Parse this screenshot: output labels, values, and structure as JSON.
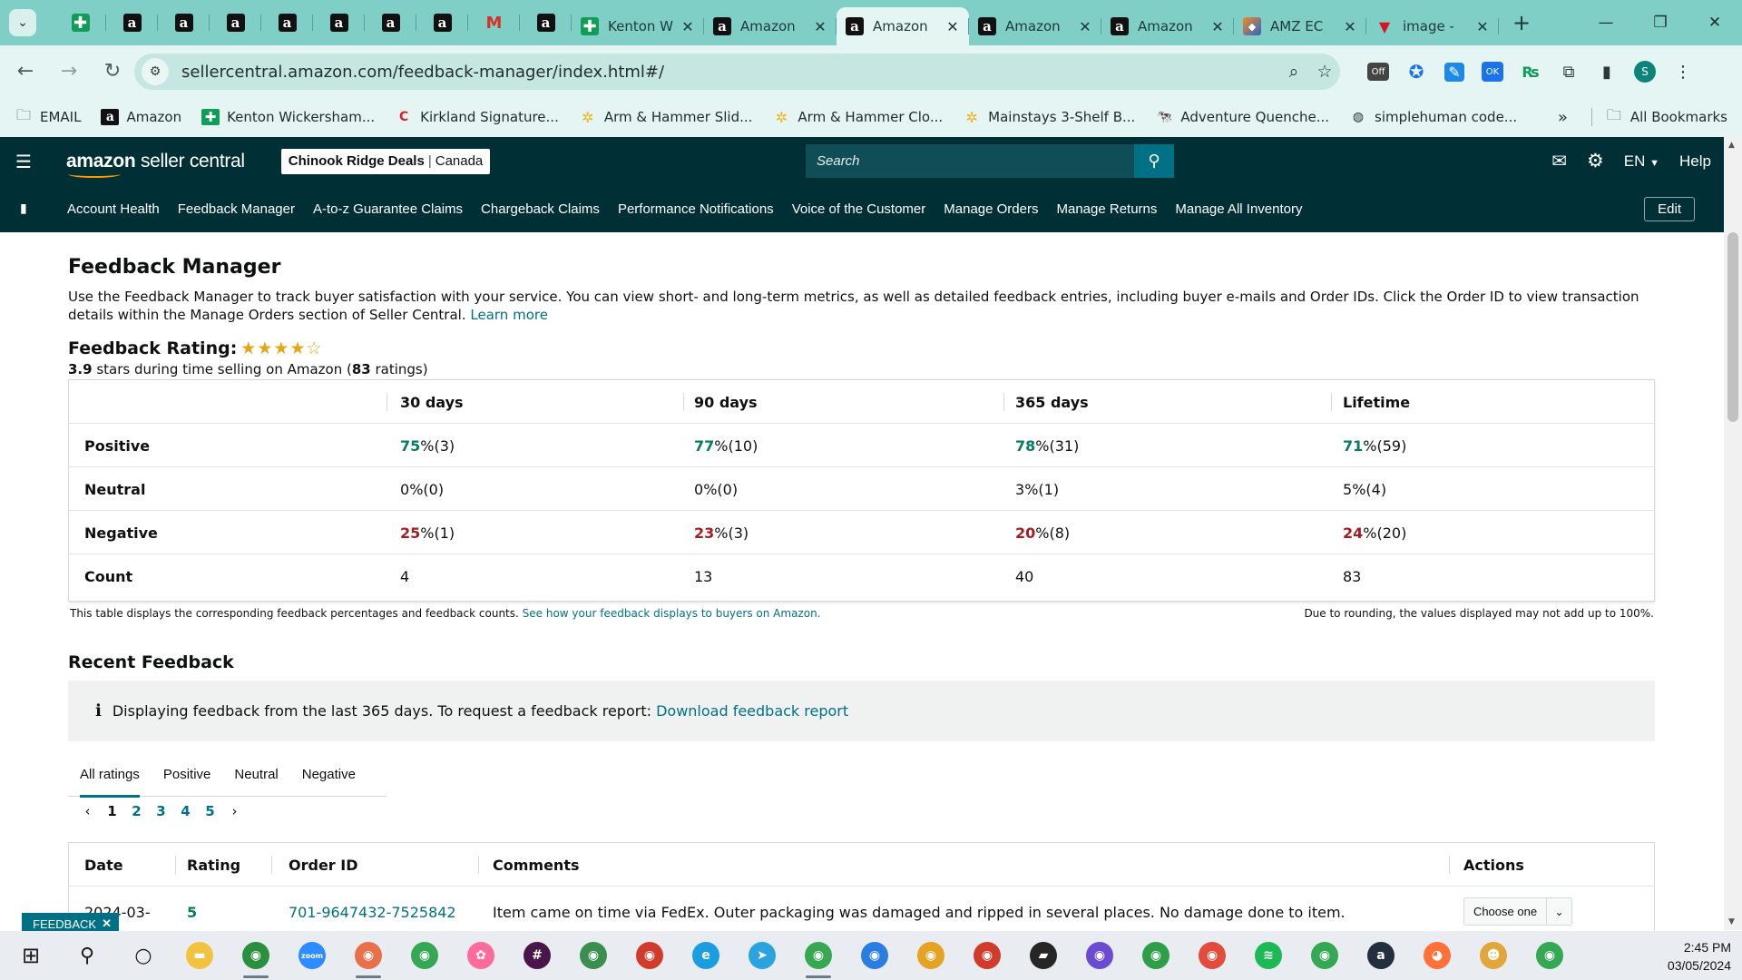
{
  "browser": {
    "pinned_tabs": [
      {
        "type": "sheets",
        "glyph": "✚"
      },
      {
        "type": "amazon",
        "glyph": "a"
      },
      {
        "type": "amazon",
        "glyph": "a"
      },
      {
        "type": "amazon",
        "glyph": "a"
      },
      {
        "type": "amazon",
        "glyph": "a"
      },
      {
        "type": "amazon",
        "glyph": "a"
      },
      {
        "type": "amazon",
        "glyph": "a"
      },
      {
        "type": "amazon",
        "glyph": "a"
      },
      {
        "type": "gmail",
        "glyph": "M"
      },
      {
        "type": "amazon",
        "glyph": "a"
      }
    ],
    "tabs": [
      {
        "title": "Kenton W",
        "icon": "sheets",
        "glyph": "✚",
        "active": false
      },
      {
        "title": "Amazon",
        "icon": "amazon",
        "glyph": "a",
        "active": false
      },
      {
        "title": "Amazon",
        "icon": "amazon",
        "glyph": "a",
        "active": true
      },
      {
        "title": "Amazon",
        "icon": "amazon",
        "glyph": "a",
        "active": false
      },
      {
        "title": "Amazon",
        "icon": "amazon",
        "glyph": "a",
        "active": false
      },
      {
        "title": "AMZ EC",
        "icon": "amz",
        "glyph": "◆",
        "active": false
      },
      {
        "title": "image -",
        "icon": "red",
        "glyph": "▼",
        "active": false
      }
    ],
    "tab_close": "✕",
    "new_tab": "+",
    "url": "sellercentral.amazon.com/feedback-manager/index.html#/",
    "extensions": [
      "zoom-icon",
      "star-icon",
      "off-extension-icon",
      "puzzle-ring-icon",
      "blue-note-icon",
      "ok-extension-icon",
      "rs-icon",
      "puzzle-icon",
      "sidepanel-icon",
      "profile-avatar"
    ],
    "profile_initial": "S",
    "ext_off_label": "Off",
    "ext_ok_label": "OK",
    "ext_rs_label": "₨",
    "bookmarks": [
      {
        "label": "EMAIL",
        "icon": "folder"
      },
      {
        "label": "Amazon",
        "icon": "amazon"
      },
      {
        "label": "Kenton Wickersham...",
        "icon": "sheets"
      },
      {
        "label": "Kirkland Signature...",
        "icon": "red"
      },
      {
        "label": "Arm & Hammer Slid...",
        "icon": "sun"
      },
      {
        "label": "Arm & Hammer Clo...",
        "icon": "sun"
      },
      {
        "label": "Mainstays 3-Shelf B...",
        "icon": "sun"
      },
      {
        "label": "Adventure Quenche...",
        "icon": "cow"
      },
      {
        "label": "simplehuman code...",
        "icon": "globe"
      }
    ],
    "bookmarks_overflow": "»",
    "all_bookmarks": "All Bookmarks"
  },
  "header": {
    "logo_main": "amazon",
    "logo_sub": "seller central",
    "store_name": "Chinook Ridge Deals",
    "store_region": "Canada",
    "search_placeholder": "Search",
    "language": "EN",
    "help": "Help"
  },
  "nav": {
    "items": [
      "Account Health",
      "Feedback Manager",
      "A-to-z Guarantee Claims",
      "Chargeback Claims",
      "Performance Notifications",
      "Voice of the Customer",
      "Manage Orders",
      "Manage Returns",
      "Manage All Inventory"
    ],
    "edit": "Edit"
  },
  "page": {
    "title": "Feedback Manager",
    "description": "Use the Feedback Manager to track buyer satisfaction with your service. You can view short- and long-term metrics, as well as detailed feedback entries, including buyer e-mails and Order IDs. Click the Order ID to view transaction details within the Manage Orders section of Seller Central.",
    "learn_more": "Learn more",
    "rating_label": "Feedback Rating:",
    "rating_stars": 4,
    "rating_value": "3.9",
    "rating_text_mid": " stars during time selling on Amazon (",
    "rating_count": "83",
    "rating_text_end": " ratings)"
  },
  "feedback_table": {
    "columns": [
      "30 days",
      "90 days",
      "365 days",
      "Lifetime"
    ],
    "rows": [
      {
        "label": "Positive",
        "color": "green",
        "cells": [
          {
            "pct": "75",
            "rest": " %(3)"
          },
          {
            "pct": "77",
            "rest": " %(10)"
          },
          {
            "pct": "78",
            "rest": " %(31)"
          },
          {
            "pct": "71",
            "rest": " %(59)"
          }
        ]
      },
      {
        "label": "Neutral",
        "color": "none",
        "cells": [
          {
            "pct": "0",
            "rest": " %(0)"
          },
          {
            "pct": "0",
            "rest": " %(0)"
          },
          {
            "pct": "3",
            "rest": " %(1)"
          },
          {
            "pct": "5",
            "rest": " %(4)"
          }
        ]
      },
      {
        "label": "Negative",
        "color": "red",
        "cells": [
          {
            "pct": "25",
            "rest": " %(1)"
          },
          {
            "pct": "23",
            "rest": " %(3)"
          },
          {
            "pct": "20",
            "rest": " %(8)"
          },
          {
            "pct": "24",
            "rest": " %(20)"
          }
        ]
      },
      {
        "label": "Count",
        "color": "none",
        "cells": [
          {
            "pct": "4",
            "rest": ""
          },
          {
            "pct": "13",
            "rest": ""
          },
          {
            "pct": "40",
            "rest": ""
          },
          {
            "pct": "83",
            "rest": ""
          }
        ]
      }
    ],
    "note": "This table displays the corresponding feedback percentages and feedback counts.",
    "note_link": "See how your feedback displays to buyers on Amazon.",
    "note_right": "Due to rounding, the values displayed may not add up to 100%."
  },
  "recent": {
    "title": "Recent Feedback",
    "info": "Displaying feedback from the last 365 days. To request a feedback report:",
    "info_link": "Download feedback report",
    "tabs": [
      "All ratings",
      "Positive",
      "Neutral",
      "Negative"
    ],
    "pages": [
      "1",
      "2",
      "3",
      "4",
      "5"
    ],
    "columns": [
      "Date",
      "Rating",
      "Order ID",
      "Comments",
      "Actions"
    ],
    "rows": [
      {
        "date": "2024-03-",
        "rating": "5",
        "order_id": "701-9647432-7525842",
        "comment": "Item came on time via FedEx. Outer packaging was damaged and ripped in several places. No damage done to item.",
        "action": "Choose one"
      }
    ]
  },
  "feedback_tag": "FEEDBACK",
  "taskbar": {
    "time": "2:45 PM",
    "date": "03/05/2024",
    "apps": [
      {
        "name": "search-icon",
        "glyph": "⚲",
        "color": "#e9ecf1"
      },
      {
        "name": "cortana-icon",
        "glyph": "○",
        "color": "#e9ecf1"
      },
      {
        "name": "file-explorer-icon",
        "glyph": "▬",
        "color": "#f3c33f"
      },
      {
        "name": "chrome-icon",
        "glyph": "◉",
        "color": "#2a8f3f"
      },
      {
        "name": "zoom-icon",
        "glyph": "zoom",
        "color": "#2d8cff"
      },
      {
        "name": "chrome-icon",
        "glyph": "◉",
        "color": "#e8704a"
      },
      {
        "name": "chrome-icon",
        "glyph": "◉",
        "color": "#34a853"
      },
      {
        "name": "fan-icon",
        "glyph": "✿",
        "color": "#ff6b9a"
      },
      {
        "name": "slack-icon",
        "glyph": "#",
        "color": "#4a154b"
      },
      {
        "name": "chrome-icon",
        "glyph": "◉",
        "color": "#3a8f4f"
      },
      {
        "name": "chrome-icon",
        "glyph": "◉",
        "color": "#d03b2b"
      },
      {
        "name": "edge-icon",
        "glyph": "e",
        "color": "#1b9de2"
      },
      {
        "name": "telegram-icon",
        "glyph": "➤",
        "color": "#2aa3df"
      },
      {
        "name": "chrome-icon",
        "glyph": "◉",
        "color": "#36a852"
      },
      {
        "name": "chrome-icon",
        "glyph": "◉",
        "color": "#2a7de1"
      },
      {
        "name": "chrome-icon",
        "glyph": "◉",
        "color": "#e5a321"
      },
      {
        "name": "chrome-icon",
        "glyph": "◉",
        "color": "#d03b2b"
      },
      {
        "name": "sticky-notes-icon",
        "glyph": "▰",
        "color": "#262626"
      },
      {
        "name": "chrome-icon",
        "glyph": "◉",
        "color": "#6b4bd1"
      },
      {
        "name": "chrome-icon",
        "glyph": "◉",
        "color": "#2f9e48"
      },
      {
        "name": "chrome-icon",
        "glyph": "◉",
        "color": "#e34b3a"
      },
      {
        "name": "spotify-icon",
        "glyph": "≋",
        "color": "#1db954"
      },
      {
        "name": "chrome-icon",
        "glyph": "◉",
        "color": "#34a853"
      },
      {
        "name": "amazon-icon",
        "glyph": "a",
        "color": "#232f3e"
      },
      {
        "name": "firefox-icon",
        "glyph": "◕",
        "color": "#ff7139"
      },
      {
        "name": "cowboy-icon",
        "glyph": "☻",
        "color": "#e2a63b"
      },
      {
        "name": "chrome-icon",
        "glyph": "◉",
        "color": "#34a853"
      }
    ]
  },
  "colors": {
    "chrome_tab_bg": "#7fcfc7",
    "chrome_toolbar_bg": "#e5f5f3",
    "sc_header_bg": "#002f36",
    "link": "#007185",
    "positive": "#067d62",
    "negative": "#a31e22",
    "star": "#e7a413"
  }
}
